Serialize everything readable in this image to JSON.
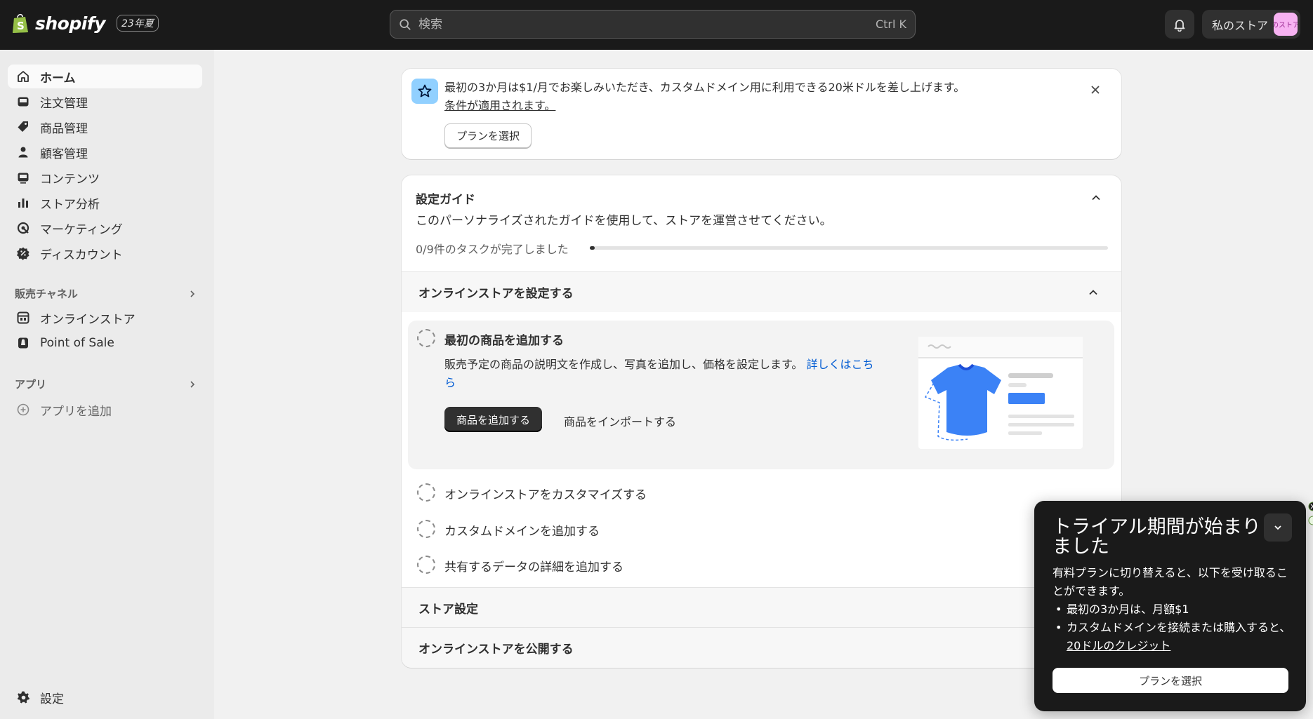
{
  "header": {
    "brand": "shopify",
    "edition": "23年夏",
    "search_placeholder": "検索",
    "search_shortcut": "Ctrl K",
    "store_name": "私のストア",
    "avatar_text": "のストア"
  },
  "sidebar": {
    "items": [
      {
        "label": "ホーム",
        "icon": "home-icon"
      },
      {
        "label": "注文管理",
        "icon": "inbox-icon"
      },
      {
        "label": "商品管理",
        "icon": "tag-icon"
      },
      {
        "label": "顧客管理",
        "icon": "person-icon"
      },
      {
        "label": "コンテンツ",
        "icon": "image-icon"
      },
      {
        "label": "ストア分析",
        "icon": "bar-chart-icon"
      },
      {
        "label": "マーケティング",
        "icon": "target-icon"
      },
      {
        "label": "ディスカウント",
        "icon": "discount-icon"
      }
    ],
    "sales_channels_label": "販売チャネル",
    "channels": [
      {
        "label": "オンラインストア",
        "icon": "store-icon"
      },
      {
        "label": "Point of Sale",
        "icon": "pos-icon"
      }
    ],
    "apps_label": "アプリ",
    "add_app_label": "アプリを追加",
    "settings_label": "設定"
  },
  "banner": {
    "text": "最初の3か月は$1/月でお楽しみいただき、カスタムドメイン用に利用できる20米ドルを差し上げます。",
    "link": "条件が適用されます。",
    "button": "プランを選択"
  },
  "guide": {
    "title": "設定ガイド",
    "description": "このパーソナライズされたガイドを使用して、ストアを運営させてください。",
    "progress_text": "0/9件のタスクが完了しました",
    "progress_fraction": 0.01,
    "section_online_store": "オンラインストアを設定する",
    "task_add_product": {
      "title": "最初の商品を追加する",
      "description": "販売予定の商品の説明文を作成し、写真を追加し、価格を設定します。",
      "link": "詳しくはこちら",
      "primary_button": "商品を追加する",
      "secondary_button": "商品をインポートする"
    },
    "tasks": [
      "オンラインストアをカスタマイズする",
      "カスタムドメインを追加する",
      "共有するデータの詳細を追加する"
    ],
    "section_store_settings": "ストア設定",
    "section_publish": "オンラインストアを公開する"
  },
  "popup": {
    "title": "トライアル期間が始まりました",
    "intro": "有料プランに切り替えると、以下を受け取ることができます。",
    "bullet_1": "最初の3か月は、月額$1",
    "bullet_2_prefix": "カスタムドメインを接続または購入すると、",
    "bullet_2_link": "20ドルのクレジット",
    "button": "プランを選択"
  },
  "colors": {
    "topbar": "#1a1a1a",
    "sidebar": "#ebebeb",
    "accent_link": "#005bd3",
    "banner_icon_bg": "#91d0ff",
    "avatar_bg": "#f7b2f2"
  }
}
